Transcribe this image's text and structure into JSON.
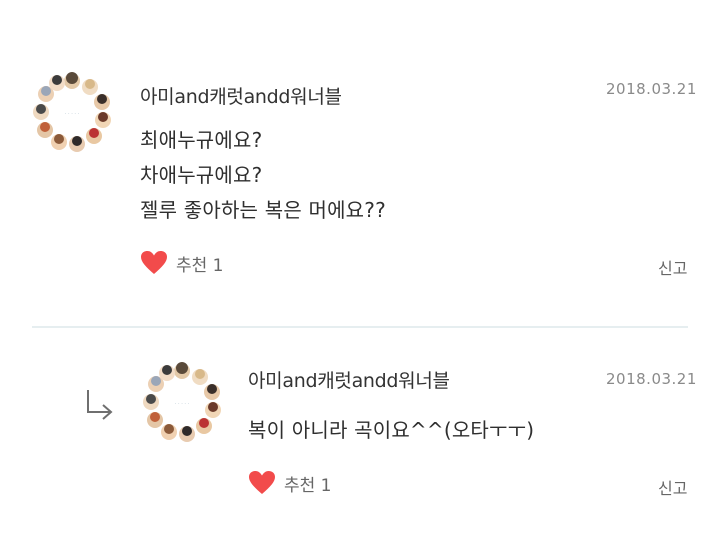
{
  "comments": [
    {
      "author": "아미and캐럿andd워너블",
      "date": "2018.03.21",
      "lines": [
        "최애누규에요?",
        "차애누규에요?",
        "젤루 좋아하는 복은 머에요??"
      ],
      "like_label": "추천 1",
      "report_label": "신고"
    },
    {
      "author": "아미and캐럿andd워너블",
      "date": "2018.03.21",
      "lines": [
        "복이 아니라 곡이요^^(오타ㅜㅜ)"
      ],
      "like_label": "추천 1",
      "report_label": "신고"
    }
  ],
  "colors": {
    "heart": "#f24b4b",
    "divider": "#e6eef0",
    "date": "#8a8a8a"
  },
  "icons": {
    "like": "heart-icon",
    "reply": "reply-arrow-icon",
    "avatar": "avatar-ring-image"
  }
}
